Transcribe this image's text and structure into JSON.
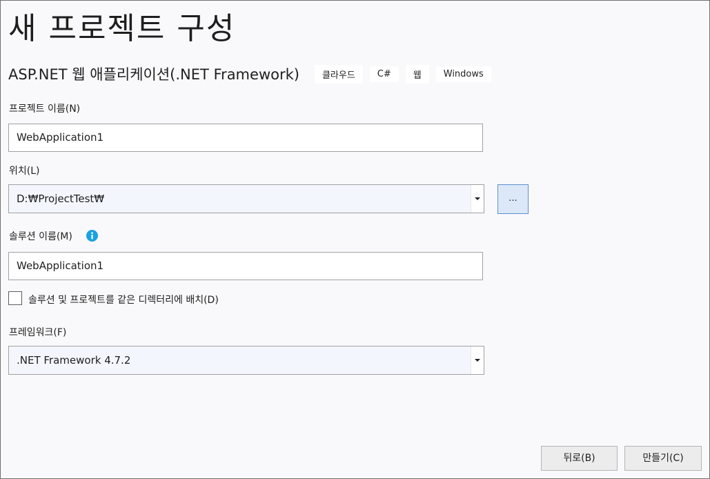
{
  "page_title": "새 프로젝트 구성",
  "template": {
    "name": "ASP.NET 웹 애플리케이션(.NET Framework)",
    "tags": [
      "클라우드",
      "C#",
      "웹",
      "Windows"
    ]
  },
  "project_name": {
    "label": "프로젝트 이름(N)",
    "value": "WebApplication1"
  },
  "location": {
    "label": "위치(L)",
    "value": "D:₩ProjectTest₩",
    "browse_label": "..."
  },
  "solution_name": {
    "label": "솔루션 이름(M)",
    "value": "WebApplication1",
    "icon": "info-icon"
  },
  "same_directory": {
    "label": "솔루션 및 프로젝트를 같은 디렉터리에 배치(D)",
    "checked": false
  },
  "framework": {
    "label": "프레임워크(F)",
    "value": ".NET Framework 4.7.2"
  },
  "buttons": {
    "back": "뒤로(B)",
    "create": "만들기(C)"
  },
  "colors": {
    "accent": "#1ba1e2",
    "browse_button_bg": "#dce8f7",
    "browse_button_border": "#5b8fd0"
  }
}
